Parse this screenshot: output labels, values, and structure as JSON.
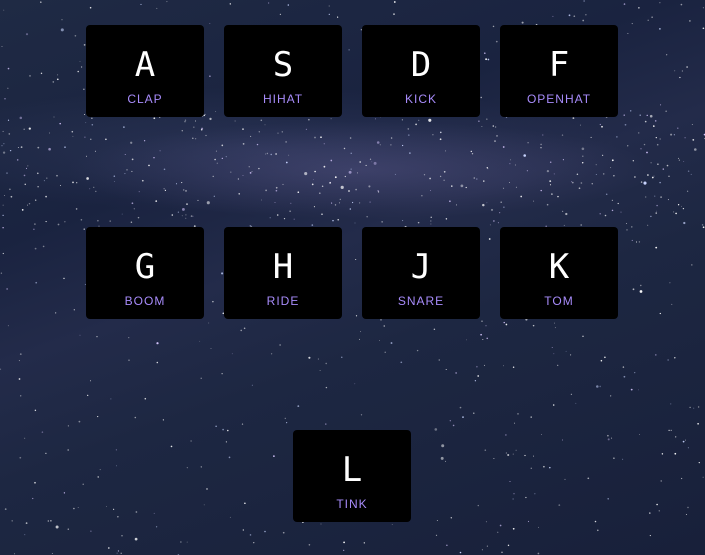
{
  "keys": [
    {
      "letter": "A",
      "sound": "CLAP"
    },
    {
      "letter": "S",
      "sound": "HIHAT"
    },
    {
      "letter": "D",
      "sound": "KICK"
    },
    {
      "letter": "F",
      "sound": "OPENHAT"
    },
    {
      "letter": "G",
      "sound": "BOOM"
    },
    {
      "letter": "H",
      "sound": "RIDE"
    },
    {
      "letter": "J",
      "sound": "SNARE"
    },
    {
      "letter": "K",
      "sound": "TOM"
    },
    {
      "letter": "L",
      "sound": "TINK"
    }
  ],
  "colors": {
    "key_background": "#000000",
    "letter": "#ffffff",
    "sound_label": "#a78bfa"
  }
}
